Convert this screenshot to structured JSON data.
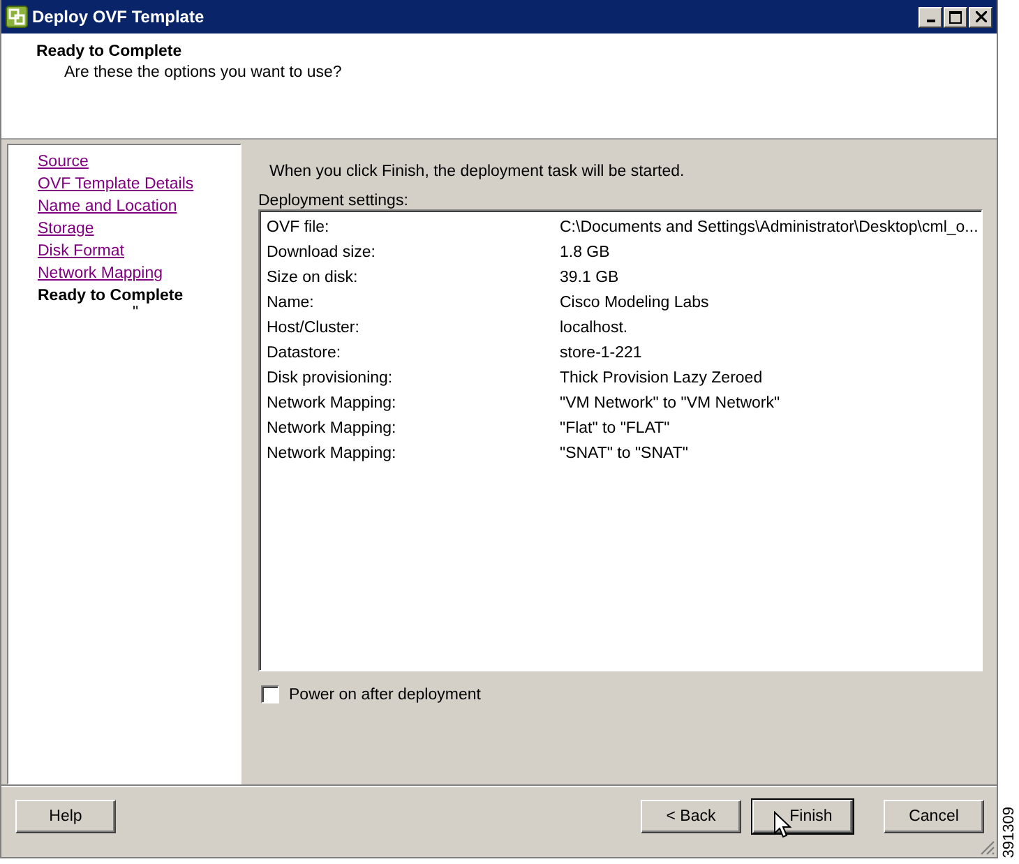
{
  "window": {
    "title": "Deploy OVF Template"
  },
  "header": {
    "title": "Ready to Complete",
    "subtitle": "Are these the options you want to use?"
  },
  "sidebar": {
    "items": [
      {
        "label": "Source",
        "selected": false
      },
      {
        "label": "OVF Template Details",
        "selected": false
      },
      {
        "label": "Name and Location",
        "selected": false
      },
      {
        "label": "Storage",
        "selected": false
      },
      {
        "label": "Disk Format",
        "selected": false
      },
      {
        "label": "Network Mapping",
        "selected": false
      },
      {
        "label": "Ready to Complete",
        "selected": true
      }
    ],
    "stray_mark": "\""
  },
  "intro": "When you click Finish, the deployment task will be started.",
  "settings": {
    "label": "Deployment settings:",
    "rows": [
      {
        "name": "OVF file:",
        "value": "C:\\Documents and Settings\\Administrator\\Desktop\\cml_o..."
      },
      {
        "name": "Download size:",
        "value": "1.8 GB"
      },
      {
        "name": "Size on disk:",
        "value": "39.1 GB"
      },
      {
        "name": "Name:",
        "value": "Cisco Modeling Labs"
      },
      {
        "name": "Host/Cluster:",
        "value": "localhost."
      },
      {
        "name": "Datastore:",
        "value": "store-1-221"
      },
      {
        "name": "Disk provisioning:",
        "value": "Thick Provision Lazy Zeroed"
      },
      {
        "name": "Network Mapping:",
        "value": "\"VM Network\" to \"VM Network\""
      },
      {
        "name": "Network Mapping:",
        "value": "\"Flat\" to \"FLAT\""
      },
      {
        "name": "Network Mapping:",
        "value": "\"SNAT\" to \"SNAT\""
      }
    ]
  },
  "power_on": {
    "label": "Power on after deployment",
    "checked": false
  },
  "buttons": [
    {
      "label": "Help",
      "kind": "left",
      "focused": false
    },
    {
      "label": "< Back",
      "kind": "right",
      "focused": false
    },
    {
      "label": "Finish",
      "kind": "right",
      "focused": true
    },
    {
      "label": "Cancel",
      "kind": "right",
      "focused": false
    }
  ],
  "figure_number": "391309"
}
